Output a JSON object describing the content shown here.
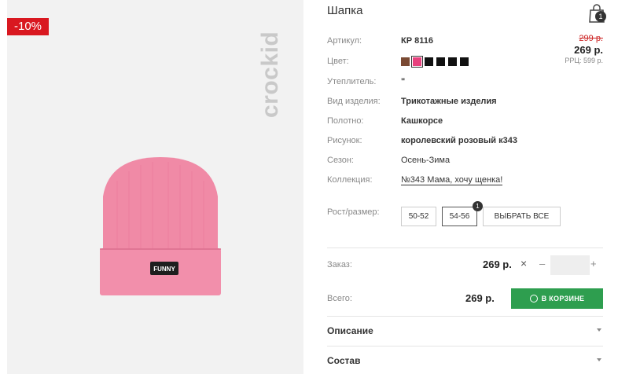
{
  "badge": {
    "discount": "-10%"
  },
  "brand": "crockid",
  "hat_label": "FUNNY",
  "product": {
    "title": "Шапка"
  },
  "cart": {
    "count": "1"
  },
  "price": {
    "old": "299 р.",
    "new": "269 р.",
    "rrp": "РРЦ: 599 р."
  },
  "attributes": [
    {
      "label": "Артикул:",
      "value": "КР 8116"
    },
    {
      "label": "Цвет:",
      "value": ""
    },
    {
      "label": "Утеплитель:",
      "value": "\""
    },
    {
      "label": "Вид изделия:",
      "value": "Трикотажные изделия"
    },
    {
      "label": "Полотно:",
      "value": "Кашкорсе"
    },
    {
      "label": "Рисунок:",
      "value": "королевский розовый к343"
    },
    {
      "label": "Сезон:",
      "value": "Осень-Зима"
    },
    {
      "label": "Коллекция:",
      "value": "№343 Мама, хочу щенка!"
    }
  ],
  "colors": [
    "#7a4a33",
    "#e8417e",
    "#111111",
    "#111111",
    "#111111",
    "#111111"
  ],
  "sizes": {
    "label": "Рост/размер:",
    "options": [
      "50-52",
      "54-56"
    ],
    "selected_count": "1",
    "select_all": "ВЫБРАТЬ ВСЕ"
  },
  "order": {
    "label": "Заказ:",
    "price": "269 р.",
    "times": "×",
    "minus": "–",
    "plus": "+"
  },
  "total": {
    "label": "Всего:",
    "price": "269 р.",
    "button": "В КОРЗИНЕ"
  },
  "accordion": {
    "description": "Описание",
    "composition": "Состав"
  }
}
